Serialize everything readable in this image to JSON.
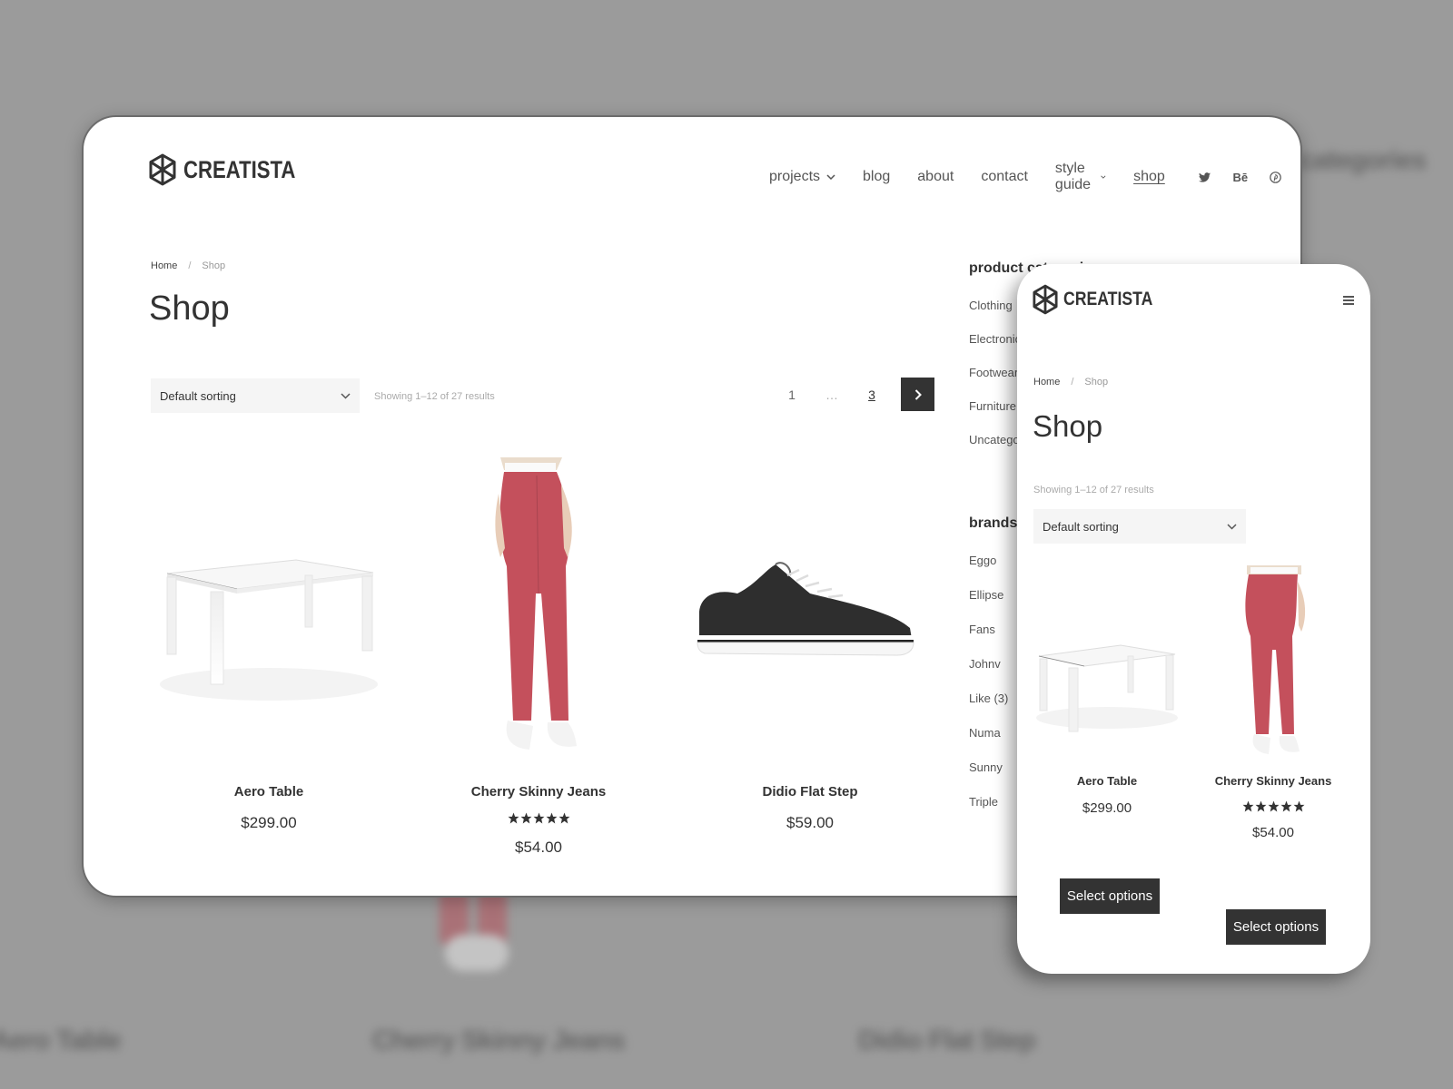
{
  "brand": {
    "name": "CREATISTA",
    "logo_icon": "hexagon-logo-icon"
  },
  "nav": {
    "items": [
      {
        "label": "projects",
        "has_dropdown": true,
        "active": false
      },
      {
        "label": "blog",
        "has_dropdown": false,
        "active": false
      },
      {
        "label": "about",
        "has_dropdown": false,
        "active": false
      },
      {
        "label": "contact",
        "has_dropdown": false,
        "active": false
      },
      {
        "label": "style guide",
        "has_dropdown": true,
        "active": false
      },
      {
        "label": "shop",
        "has_dropdown": false,
        "active": true
      }
    ],
    "social": [
      {
        "icon": "twitter-icon"
      },
      {
        "icon": "behance-icon",
        "glyph": "Bē"
      },
      {
        "icon": "pinterest-icon"
      }
    ]
  },
  "breadcrumb": {
    "home": "Home",
    "separator": "/",
    "current": "Shop"
  },
  "page": {
    "title": "Shop"
  },
  "toolbar": {
    "sort_selected": "Default sorting",
    "results_text": "Showing 1–12 of 27 results"
  },
  "pagination": {
    "first": "1",
    "dots": "…",
    "last": "3",
    "current": "3"
  },
  "products": [
    {
      "name": "Aero Table",
      "price": "$299.00",
      "rating": null,
      "image": "white-table"
    },
    {
      "name": "Cherry Skinny Jeans",
      "price": "$54.00",
      "rating": 5,
      "image": "red-jeans"
    },
    {
      "name": "Didio Flat Step",
      "price": "$59.00",
      "rating": null,
      "image": "black-sneaker"
    }
  ],
  "sidebar": {
    "categories_title": "product categories",
    "categories": [
      "Clothing",
      "Electronics",
      "Footwear",
      "Furniture",
      "Uncategorized"
    ],
    "brands_title": "brands",
    "brands": [
      "Eggo",
      "Ellipse",
      "Fans",
      "Johnv",
      "Like (3)",
      "Numa",
      "Sunny",
      "Triple"
    ]
  },
  "mobile": {
    "menu_icon": "hamburger-icon",
    "button_label": "Select options",
    "products": [
      {
        "name": "Aero Table",
        "price": "$299.00",
        "rating": null
      },
      {
        "name": "Cherry Skinny Jeans",
        "price": "$54.00",
        "rating": 5
      }
    ]
  },
  "background": {
    "blurred_titles": [
      "Aero Table",
      "Cherry Skinny Jeans",
      "Didio Flat Step"
    ],
    "blurred_sidebar_title": "categories"
  },
  "colors": {
    "background": "#9b9b9b",
    "text_dark": "#333333",
    "button_bg": "#333333",
    "jeans_red": "#c4505c"
  }
}
